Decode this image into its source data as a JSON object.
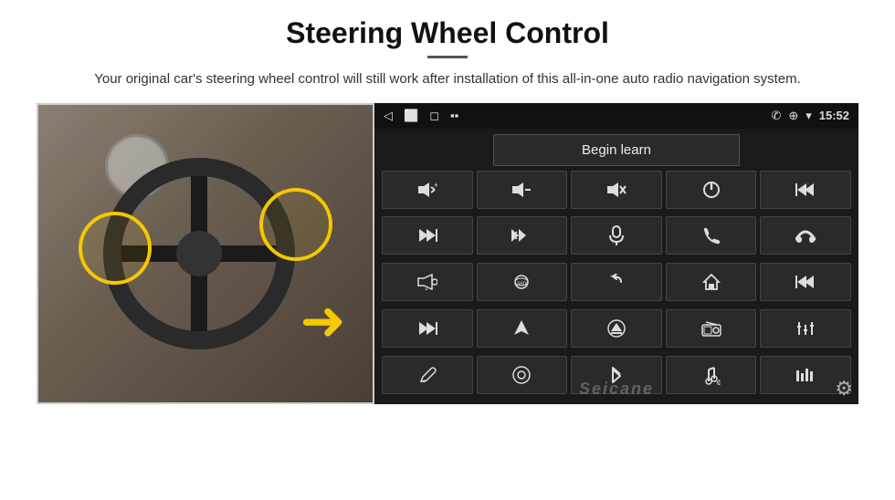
{
  "header": {
    "title": "Steering Wheel Control",
    "divider": true,
    "subtitle": "Your original car's steering wheel control will still work after installation of this all-in-one auto radio navigation system."
  },
  "android_ui": {
    "status_bar": {
      "back_icon": "◁",
      "home_icon": "⬜",
      "recent_icon": "◻",
      "signal_icon": "▪▪",
      "phone_icon": "✆",
      "location_icon": "⊕",
      "wifi_icon": "▾",
      "time": "15:52"
    },
    "begin_learn_label": "Begin learn",
    "grid_icons": [
      {
        "id": "vol-up",
        "symbol": "🔊+"
      },
      {
        "id": "vol-down",
        "symbol": "🔉−"
      },
      {
        "id": "mute",
        "symbol": "🔇"
      },
      {
        "id": "power",
        "symbol": "⏻"
      },
      {
        "id": "prev-track",
        "symbol": "⏮"
      },
      {
        "id": "next-track",
        "symbol": "⏭"
      },
      {
        "id": "fast-forward",
        "symbol": "⏩"
      },
      {
        "id": "mic",
        "symbol": "🎤"
      },
      {
        "id": "phone",
        "symbol": "📞"
      },
      {
        "id": "hang-up",
        "symbol": "📵"
      },
      {
        "id": "horn",
        "symbol": "📣"
      },
      {
        "id": "cam-360",
        "symbol": "🔄"
      },
      {
        "id": "back",
        "symbol": "↩"
      },
      {
        "id": "home",
        "symbol": "⌂"
      },
      {
        "id": "skip-back",
        "symbol": "⏮"
      },
      {
        "id": "skip-fwd",
        "symbol": "⏭"
      },
      {
        "id": "nav",
        "symbol": "➤"
      },
      {
        "id": "eject",
        "symbol": "⏏"
      },
      {
        "id": "radio",
        "symbol": "📻"
      },
      {
        "id": "eq",
        "symbol": "🎛"
      },
      {
        "id": "pen",
        "symbol": "✏"
      },
      {
        "id": "settings2",
        "symbol": "⚙"
      },
      {
        "id": "bluetooth",
        "symbol": "₿"
      },
      {
        "id": "music",
        "symbol": "🎵"
      },
      {
        "id": "bars",
        "symbol": "📶"
      }
    ],
    "watermark": "Seicane",
    "settings_icon": "⚙"
  }
}
